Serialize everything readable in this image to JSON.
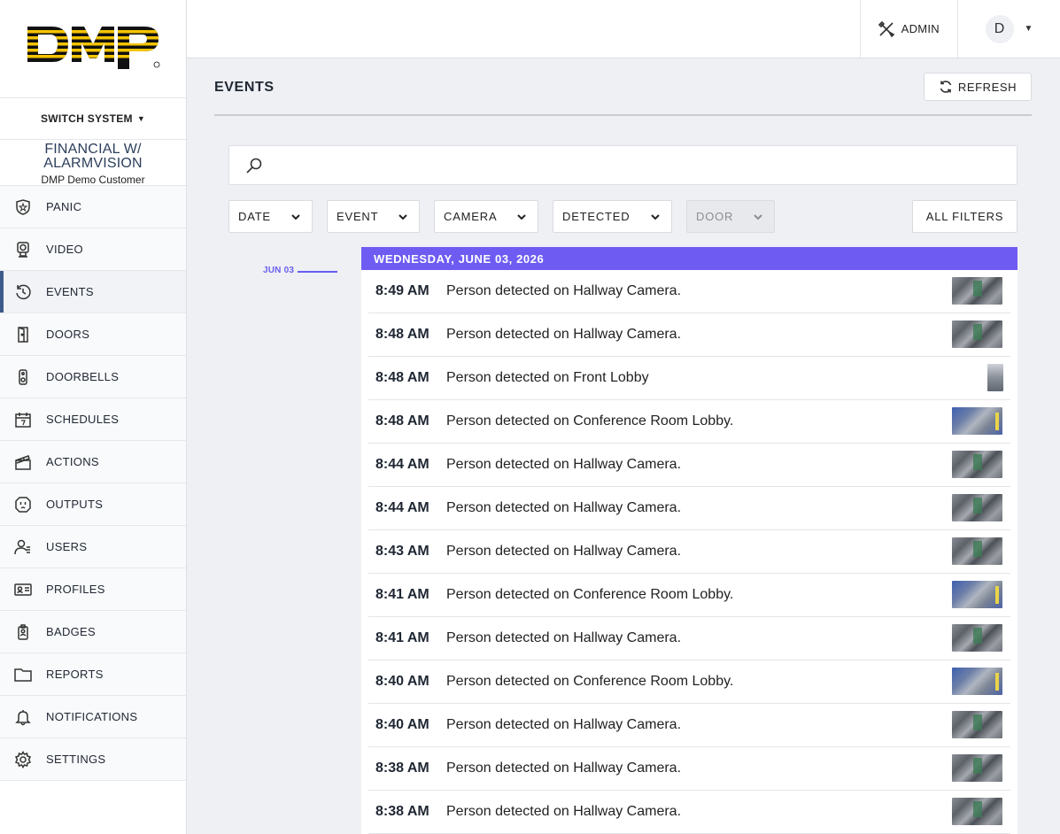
{
  "brand": {
    "logo_text": "DMP"
  },
  "sidebar": {
    "switch_system": "SWITCH SYSTEM",
    "system_name": "FINANCIAL W/ ALARMVISION",
    "customer_name": "DMP Demo Customer",
    "items": [
      {
        "label": "PANIC",
        "icon": "shield-star-icon"
      },
      {
        "label": "VIDEO",
        "icon": "camera-icon"
      },
      {
        "label": "EVENTS",
        "icon": "history-icon",
        "active": true
      },
      {
        "label": "DOORS",
        "icon": "door-icon"
      },
      {
        "label": "DOORBELLS",
        "icon": "doorbell-icon"
      },
      {
        "label": "SCHEDULES",
        "icon": "calendar-icon"
      },
      {
        "label": "ACTIONS",
        "icon": "clapperboard-icon"
      },
      {
        "label": "OUTPUTS",
        "icon": "outlet-icon"
      },
      {
        "label": "USERS",
        "icon": "users-icon"
      },
      {
        "label": "PROFILES",
        "icon": "id-card-icon"
      },
      {
        "label": "BADGES",
        "icon": "badge-icon"
      },
      {
        "label": "REPORTS",
        "icon": "folder-icon"
      },
      {
        "label": "NOTIFICATIONS",
        "icon": "bell-icon"
      },
      {
        "label": "SETTINGS",
        "icon": "gear-icon"
      }
    ]
  },
  "topbar": {
    "admin_label": "ADMIN",
    "avatar_initial": "D"
  },
  "main": {
    "title": "EVENTS",
    "refresh_label": "REFRESH",
    "search": {
      "placeholder": "",
      "value": ""
    },
    "filters": [
      {
        "label": "DATE",
        "disabled": false
      },
      {
        "label": "EVENT",
        "disabled": false
      },
      {
        "label": "CAMERA",
        "disabled": false
      },
      {
        "label": "DETECTED",
        "disabled": false
      },
      {
        "label": "DOOR",
        "disabled": true
      }
    ],
    "all_filters_label": "ALL FILTERS",
    "timeline_label": "JUN 03",
    "date_header": "WEDNESDAY, JUNE 03, 2026",
    "events": [
      {
        "time": "8:49 AM",
        "desc": "Person detected on Hallway Camera.",
        "thumb": "hallway"
      },
      {
        "time": "8:48 AM",
        "desc": "Person detected on Hallway Camera.",
        "thumb": "hallway"
      },
      {
        "time": "8:48 AM",
        "desc": "Person detected on Front Lobby",
        "thumb": "lobby"
      },
      {
        "time": "8:48 AM",
        "desc": "Person detected on Conference Room Lobby.",
        "thumb": "conference"
      },
      {
        "time": "8:44 AM",
        "desc": "Person detected on Hallway Camera.",
        "thumb": "hallway"
      },
      {
        "time": "8:44 AM",
        "desc": "Person detected on Hallway Camera.",
        "thumb": "hallway"
      },
      {
        "time": "8:43 AM",
        "desc": "Person detected on Hallway Camera.",
        "thumb": "hallway"
      },
      {
        "time": "8:41 AM",
        "desc": "Person detected on Conference Room Lobby.",
        "thumb": "conference"
      },
      {
        "time": "8:41 AM",
        "desc": "Person detected on Hallway Camera.",
        "thumb": "hallway"
      },
      {
        "time": "8:40 AM",
        "desc": "Person detected on Conference Room Lobby.",
        "thumb": "conference"
      },
      {
        "time": "8:40 AM",
        "desc": "Person detected on Hallway Camera.",
        "thumb": "hallway"
      },
      {
        "time": "8:38 AM",
        "desc": "Person detected on Hallway Camera.",
        "thumb": "hallway"
      },
      {
        "time": "8:38 AM",
        "desc": "Person detected on Hallway Camera.",
        "thumb": "hallway"
      }
    ]
  },
  "colors": {
    "accent": "#6e5cf2",
    "logo_yellow": "#f5c400",
    "nav_active_bar": "#3d5a8a"
  }
}
